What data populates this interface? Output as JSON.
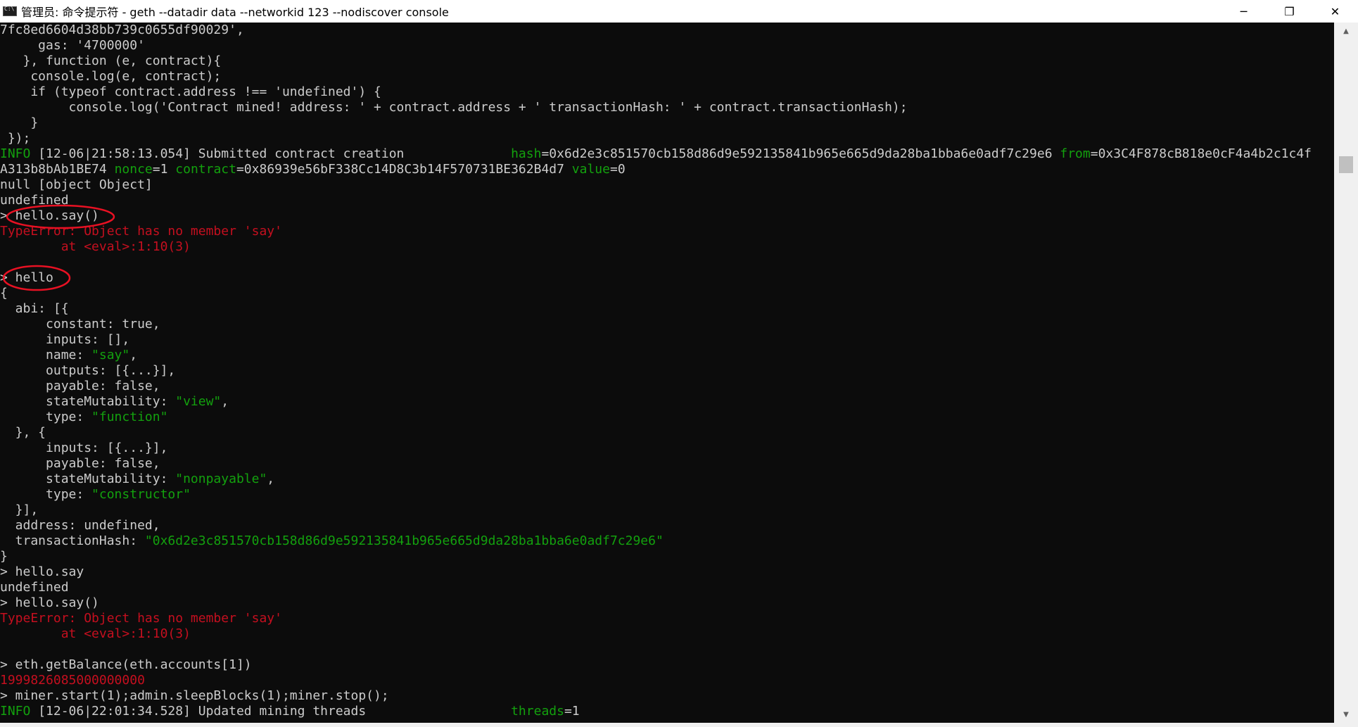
{
  "window": {
    "title": "管理员: 命令提示符 - geth  --datadir data --networkid 123 --nodiscover console",
    "minimize_glyph": "─",
    "maximize_glyph": "❐",
    "close_glyph": "✕"
  },
  "colors": {
    "background": "#0c0c0c",
    "default_text": "#cccccc",
    "green": "#13a10e",
    "red": "#c50f1f",
    "annotation": "#e81123"
  },
  "scrollbar": {
    "up_glyph": "▲",
    "down_glyph": "▼"
  },
  "lines": [
    [
      {
        "t": "7fc8ed6604d38bb739c0655df90029',",
        "c": "white"
      }
    ],
    [
      {
        "t": "     gas: '4700000'",
        "c": "white"
      }
    ],
    [
      {
        "t": "   }, function (e, contract){",
        "c": "white"
      }
    ],
    [
      {
        "t": "    console.log(e, contract);",
        "c": "white"
      }
    ],
    [
      {
        "t": "    if (typeof contract.address !== 'undefined') {",
        "c": "white"
      }
    ],
    [
      {
        "t": "         console.log('Contract mined! address: ' + contract.address + ' transactionHash: ' + contract.transactionHash);",
        "c": "white"
      }
    ],
    [
      {
        "t": "    }",
        "c": "white"
      }
    ],
    [
      {
        "t": " });",
        "c": "white"
      }
    ],
    [
      {
        "t": "INFO",
        "c": "green"
      },
      {
        "t": " [12-06|21:58:13.054] Submitted contract creation              ",
        "c": "white"
      },
      {
        "t": "hash",
        "c": "green"
      },
      {
        "t": "=0x6d2e3c851570cb158d86d9e592135841b965e665d9da28ba1bba6e0adf7c29e6 ",
        "c": "white"
      },
      {
        "t": "from",
        "c": "green"
      },
      {
        "t": "=0x3C4F878cB818e0cF4a4b2c1c4f",
        "c": "white"
      }
    ],
    [
      {
        "t": "A313b8bAb1BE74 ",
        "c": "white"
      },
      {
        "t": "nonce",
        "c": "green"
      },
      {
        "t": "=1 ",
        "c": "white"
      },
      {
        "t": "contract",
        "c": "green"
      },
      {
        "t": "=0x86939e56bF338Cc14D8C3b14F570731BE362B4d7 ",
        "c": "white"
      },
      {
        "t": "value",
        "c": "green"
      },
      {
        "t": "=0",
        "c": "white"
      }
    ],
    [
      {
        "t": "null [object Object]",
        "c": "white"
      }
    ],
    [
      {
        "t": "undefined",
        "c": "white"
      }
    ],
    [
      {
        "t": "> hello.say()",
        "c": "white"
      }
    ],
    [
      {
        "t": "TypeError: Object has no member 'say'",
        "c": "red"
      }
    ],
    [
      {
        "t": "        at <eval>:1:10(3)",
        "c": "red"
      }
    ],
    [
      {
        "t": "",
        "c": "white"
      }
    ],
    [
      {
        "t": "> hello",
        "c": "white"
      }
    ],
    [
      {
        "t": "{",
        "c": "white"
      }
    ],
    [
      {
        "t": "  abi: [{",
        "c": "white"
      }
    ],
    [
      {
        "t": "      constant: true,",
        "c": "white"
      }
    ],
    [
      {
        "t": "      inputs: [],",
        "c": "white"
      }
    ],
    [
      {
        "t": "      name: ",
        "c": "white"
      },
      {
        "t": "\"say\"",
        "c": "green"
      },
      {
        "t": ",",
        "c": "white"
      }
    ],
    [
      {
        "t": "      outputs: [{...}],",
        "c": "white"
      }
    ],
    [
      {
        "t": "      payable: false,",
        "c": "white"
      }
    ],
    [
      {
        "t": "      stateMutability: ",
        "c": "white"
      },
      {
        "t": "\"view\"",
        "c": "green"
      },
      {
        "t": ",",
        "c": "white"
      }
    ],
    [
      {
        "t": "      type: ",
        "c": "white"
      },
      {
        "t": "\"function\"",
        "c": "green"
      }
    ],
    [
      {
        "t": "  }, {",
        "c": "white"
      }
    ],
    [
      {
        "t": "      inputs: [{...}],",
        "c": "white"
      }
    ],
    [
      {
        "t": "      payable: false,",
        "c": "white"
      }
    ],
    [
      {
        "t": "      stateMutability: ",
        "c": "white"
      },
      {
        "t": "\"nonpayable\"",
        "c": "green"
      },
      {
        "t": ",",
        "c": "white"
      }
    ],
    [
      {
        "t": "      type: ",
        "c": "white"
      },
      {
        "t": "\"constructor\"",
        "c": "green"
      }
    ],
    [
      {
        "t": "  }],",
        "c": "white"
      }
    ],
    [
      {
        "t": "  address: undefined,",
        "c": "white"
      }
    ],
    [
      {
        "t": "  transactionHash: ",
        "c": "white"
      },
      {
        "t": "\"0x6d2e3c851570cb158d86d9e592135841b965e665d9da28ba1bba6e0adf7c29e6\"",
        "c": "green"
      }
    ],
    [
      {
        "t": "}",
        "c": "white"
      }
    ],
    [
      {
        "t": "> hello.say",
        "c": "white"
      }
    ],
    [
      {
        "t": "undefined",
        "c": "white"
      }
    ],
    [
      {
        "t": "> hello.say()",
        "c": "white"
      }
    ],
    [
      {
        "t": "TypeError: Object has no member 'say'",
        "c": "red"
      }
    ],
    [
      {
        "t": "        at <eval>:1:10(3)",
        "c": "red"
      }
    ],
    [
      {
        "t": "",
        "c": "white"
      }
    ],
    [
      {
        "t": "> eth.getBalance(eth.accounts[1])",
        "c": "white"
      }
    ],
    [
      {
        "t": "1999826085000000000",
        "c": "red"
      }
    ],
    [
      {
        "t": "> miner.start(1);admin.sleepBlocks(1);miner.stop();",
        "c": "white"
      }
    ],
    [
      {
        "t": "INFO",
        "c": "green"
      },
      {
        "t": " [12-06|22:01:34.528] Updated mining threads                   ",
        "c": "white"
      },
      {
        "t": "threads",
        "c": "green"
      },
      {
        "t": "=1",
        "c": "white"
      }
    ]
  ]
}
